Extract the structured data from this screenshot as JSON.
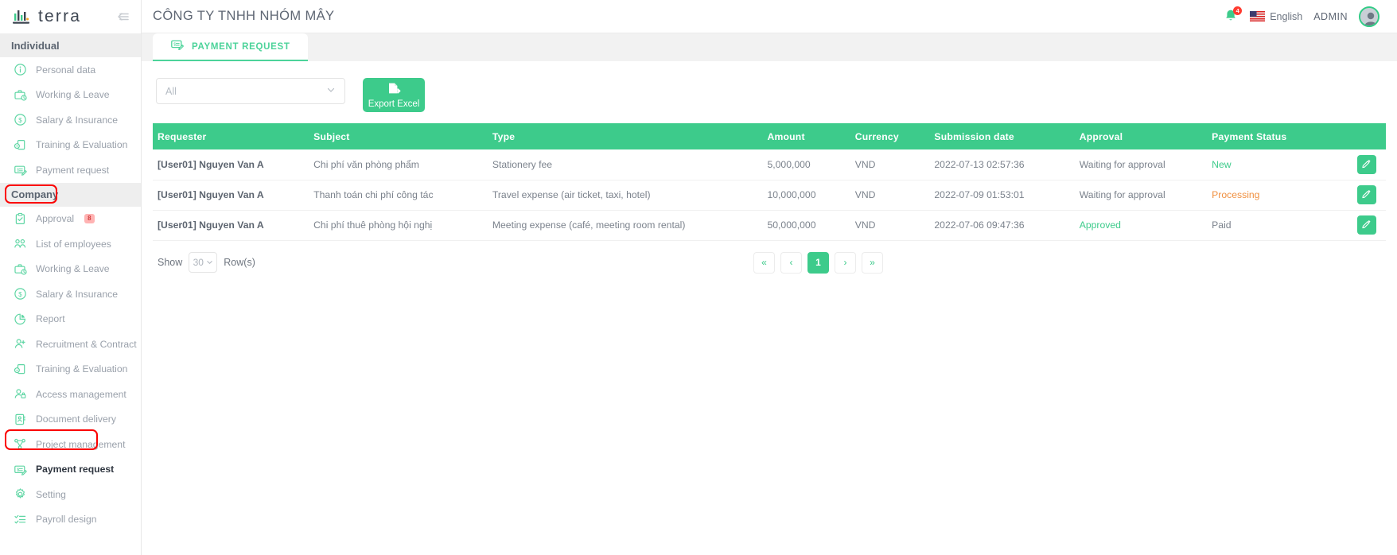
{
  "brand": {
    "name": "terra",
    "accent": "#3dcb8b"
  },
  "sidebar": {
    "collapse_icon": "collapse-left-icon",
    "sections": [
      {
        "title": "Individual",
        "items": [
          {
            "label": "Personal data",
            "icon": "info-circle-icon"
          },
          {
            "label": "Working & Leave",
            "icon": "briefcase-clock-icon"
          },
          {
            "label": "Salary & Insurance",
            "icon": "dollar-circle-icon"
          },
          {
            "label": "Training & Evaluation",
            "icon": "training-doc-icon"
          },
          {
            "label": "Payment request",
            "icon": "payment-request-icon"
          }
        ]
      },
      {
        "title": "Company",
        "items": [
          {
            "label": "Approval",
            "icon": "clipboard-check-icon",
            "badge": "8"
          },
          {
            "label": "List of employees",
            "icon": "people-group-icon"
          },
          {
            "label": "Working & Leave",
            "icon": "briefcase-clock-icon"
          },
          {
            "label": "Salary & Insurance",
            "icon": "dollar-circle-icon"
          },
          {
            "label": "Report",
            "icon": "pie-chart-icon"
          },
          {
            "label": "Recruitment & Contract",
            "icon": "person-plus-icon"
          },
          {
            "label": "Training & Evaluation",
            "icon": "training-doc-icon"
          },
          {
            "label": "Access management",
            "icon": "person-lock-icon"
          },
          {
            "label": "Document delivery",
            "icon": "document-card-icon"
          },
          {
            "label": "Project management",
            "icon": "sitemap-icon"
          },
          {
            "label": "Payment request",
            "icon": "payment-request-icon",
            "active": true
          },
          {
            "label": "Setting",
            "icon": "gear-icon"
          },
          {
            "label": "Payroll design",
            "icon": "list-checks-icon"
          }
        ]
      }
    ]
  },
  "header": {
    "title": "CÔNG TY TNHH NHÓM MÂY",
    "notification_icon": "bell-icon",
    "notification_count": "4",
    "flag_icon": "us-flag-icon",
    "language": "English",
    "user": "ADMIN",
    "avatar_icon": "avatar-icon"
  },
  "tabs": [
    {
      "label": "PAYMENT REQUEST",
      "icon": "payment-request-icon",
      "active": true
    }
  ],
  "toolbar": {
    "filter_value": "All",
    "filter_placeholder": "All",
    "chevron_icon": "chevron-down-icon",
    "export_label": "Export Excel",
    "export_icon": "export-file-icon"
  },
  "table": {
    "columns": [
      "Requester",
      "Subject",
      "Type",
      "Amount",
      "Currency",
      "Submission date",
      "Approval",
      "Payment Status"
    ],
    "rows": [
      {
        "requester": "[User01] Nguyen Van A",
        "subject": "Chi phí văn phòng phẩm",
        "type": "Stationery fee",
        "amount": "5,000,000",
        "currency": "VND",
        "submission_date": "2022-07-13 02:57:36",
        "approval": "Waiting for approval",
        "approval_color": "grey",
        "payment_status": "New",
        "payment_color": "green",
        "edit_icon": "pencil-icon"
      },
      {
        "requester": "[User01] Nguyen Van A",
        "subject": "Thanh toán chi phí công tác",
        "type": "Travel expense (air ticket, taxi, hotel)",
        "amount": "10,000,000",
        "currency": "VND",
        "submission_date": "2022-07-09 01:53:01",
        "approval": "Waiting for approval",
        "approval_color": "grey",
        "payment_status": "Processing",
        "payment_color": "orange",
        "edit_icon": "pencil-icon"
      },
      {
        "requester": "[User01] Nguyen Van A",
        "subject": "Chi phí thuê phòng hội nghị",
        "type": "Meeting expense (café, meeting room rental)",
        "amount": "50,000,000",
        "currency": "VND",
        "submission_date": "2022-07-06 09:47:36",
        "approval": "Approved",
        "approval_color": "green",
        "payment_status": "Paid",
        "payment_color": "grey",
        "edit_icon": "pencil-icon"
      }
    ]
  },
  "footer": {
    "show_label": "Show",
    "rows_value": "30",
    "rows_suffix": "Row(s)",
    "pagination": [
      {
        "label": "«",
        "name": "first"
      },
      {
        "label": "‹",
        "name": "prev"
      },
      {
        "label": "1",
        "name": "page-1",
        "active": true
      },
      {
        "label": "›",
        "name": "next"
      },
      {
        "label": "»",
        "name": "last"
      }
    ]
  }
}
